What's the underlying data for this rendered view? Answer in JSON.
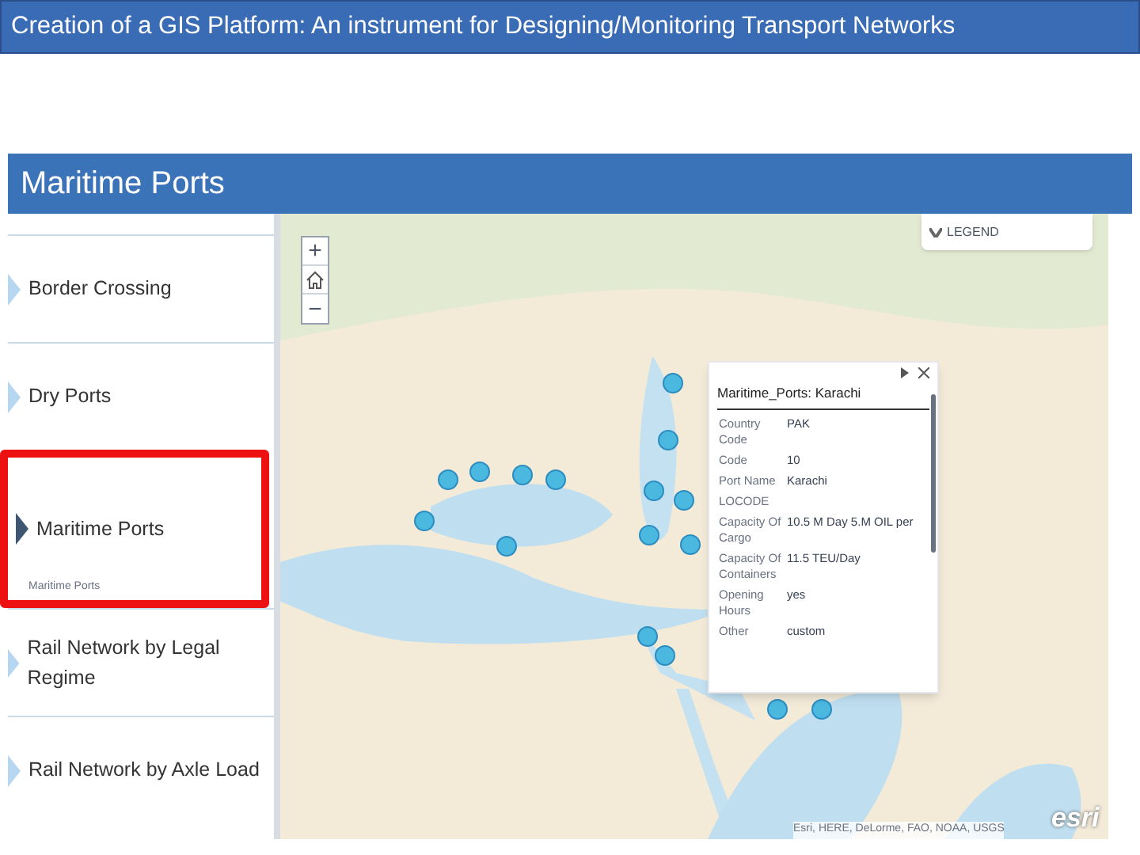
{
  "slide_title": "Creation of a GIS Platform: An instrument for Designing/Monitoring Transport Networks",
  "header": {
    "title": "Maritime Ports"
  },
  "sidebar": {
    "items": [
      {
        "label": "Border Crossing",
        "selected": false,
        "highlighted": false
      },
      {
        "label": "Dry Ports",
        "selected": false,
        "highlighted": false
      },
      {
        "label": "Maritime Ports",
        "selected": true,
        "highlighted": true,
        "subtitle": "Maritime Ports"
      },
      {
        "label": "Rail Network by Legal Regime",
        "selected": false,
        "highlighted": false
      },
      {
        "label": "Rail Network by Axle Load",
        "selected": false,
        "highlighted": false
      }
    ]
  },
  "map": {
    "zoom_in": "+",
    "zoom_out": "−",
    "legend": {
      "label": "LEGEND",
      "expanded": false
    },
    "popup": {
      "title": "Maritime_Ports: Karachi",
      "fields": [
        {
          "label": "Country Code",
          "value": "PAK"
        },
        {
          "label": "Code",
          "value": "10"
        },
        {
          "label": "Port Name",
          "value": "Karachi"
        },
        {
          "label": "LOCODE"
        },
        {
          "label": "Capacity Of Cargo",
          "value": "10.5 M Day 5.M OIL per"
        },
        {
          "label": "Capacity Of Containers",
          "value": "11.5 TEU/Day"
        },
        {
          "label": "Opening Hours",
          "value": "yes"
        },
        {
          "label": "Other",
          "value": "custom"
        }
      ]
    },
    "attribution": "Esri, HERE, DeLorme, FAO, NOAA, USGS",
    "logo": "esri"
  }
}
